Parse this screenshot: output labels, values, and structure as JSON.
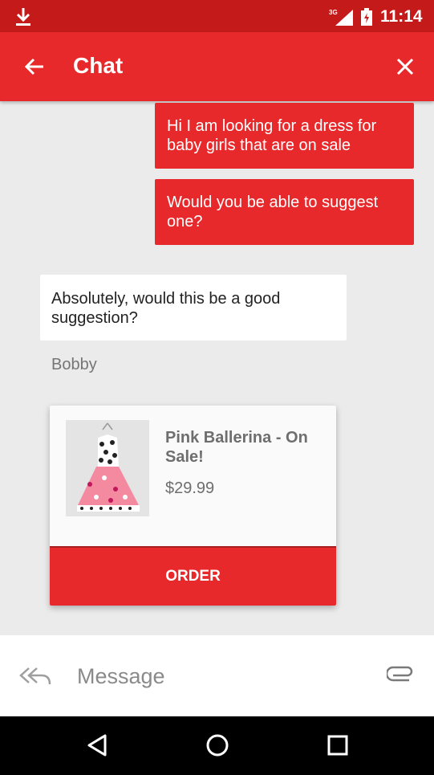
{
  "status_bar": {
    "time": "11:14",
    "network": "3G"
  },
  "app_bar": {
    "title": "Chat"
  },
  "messages": [
    {
      "text": "Hi I am looking for a dress for baby girls that are on sale"
    },
    {
      "text": "Would you be able to suggest one?"
    },
    {
      "text": "Absolutely, would this be a good suggestion?"
    }
  ],
  "sender_name": "Bobby",
  "product": {
    "name": "Pink Ballerina - On Sale!",
    "price": "$29.99",
    "order_label": "ORDER"
  },
  "composer": {
    "placeholder": "Message"
  },
  "colors": {
    "primary": "#e8292c",
    "status": "#c41a1a"
  }
}
